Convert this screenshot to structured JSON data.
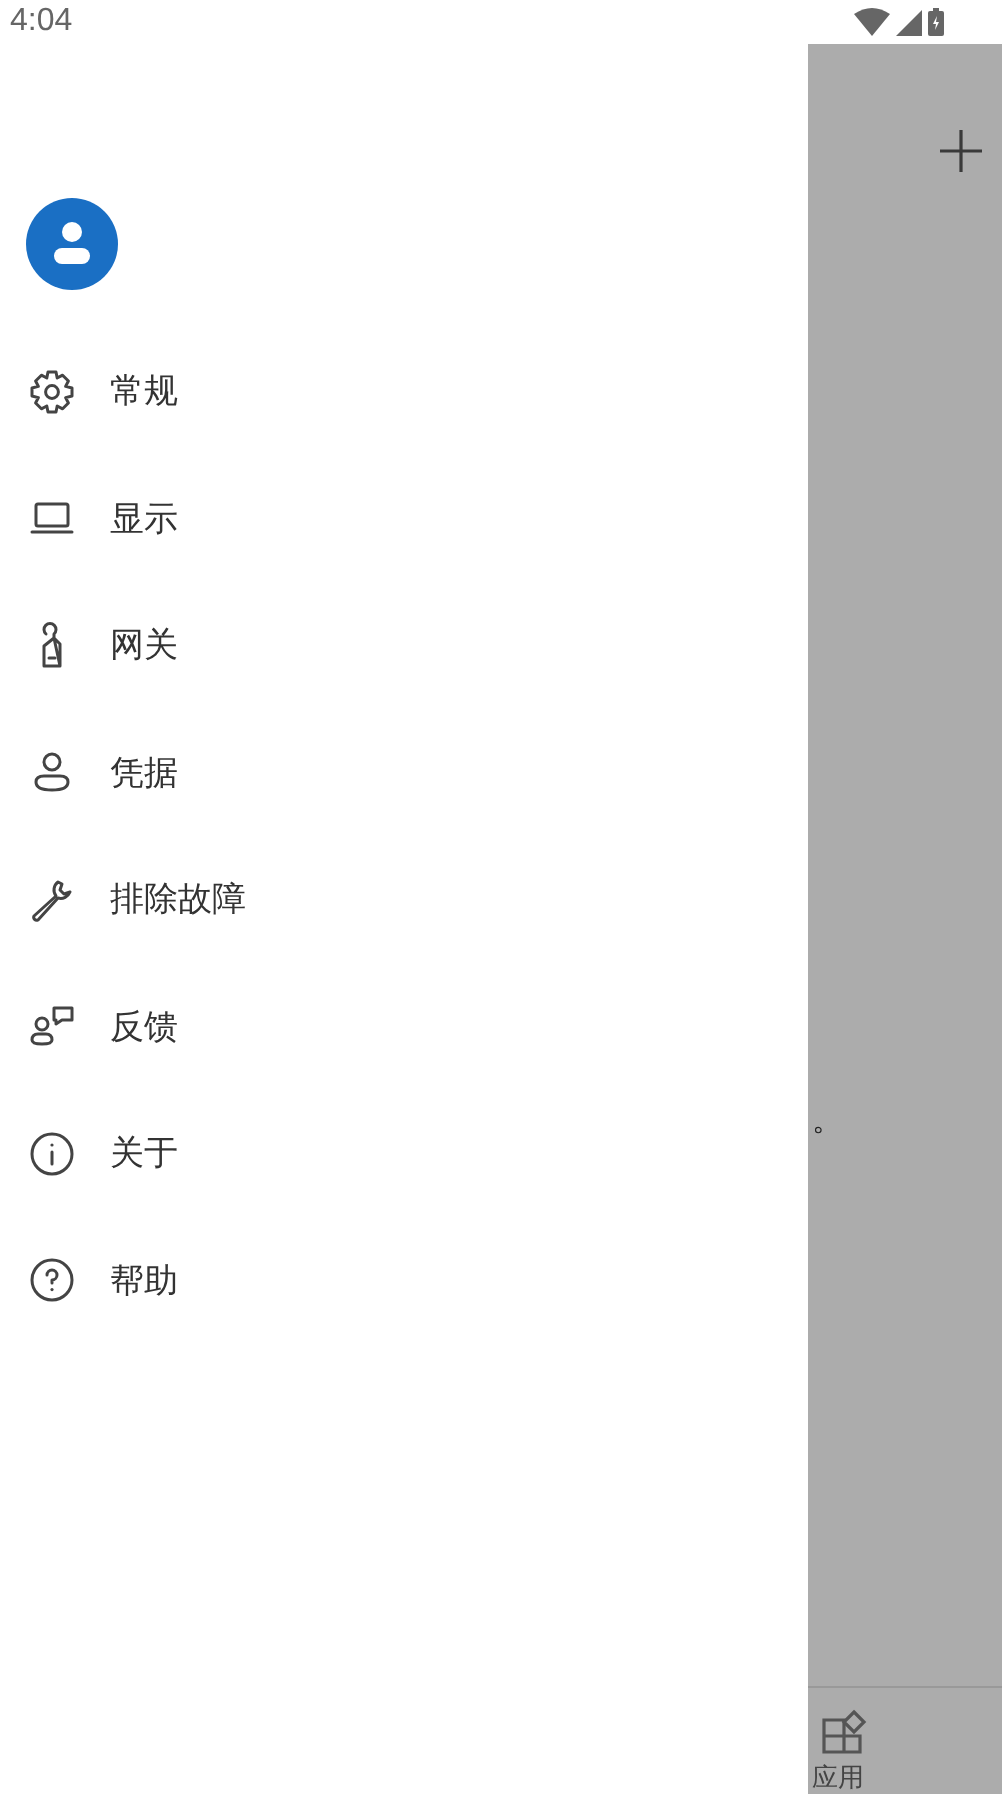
{
  "status_bar": {
    "time": "4:04"
  },
  "menu": [
    {
      "kind": "gear",
      "label": "常规"
    },
    {
      "kind": "laptop",
      "label": "显示"
    },
    {
      "kind": "tag",
      "label": "网关"
    },
    {
      "kind": "person",
      "label": "凭据"
    },
    {
      "kind": "wrench",
      "label": "排除故障"
    },
    {
      "kind": "feedback",
      "label": "反馈"
    },
    {
      "kind": "info",
      "label": "关于"
    },
    {
      "kind": "help",
      "label": "帮助"
    }
  ],
  "background": {
    "fragment": "。",
    "nav": [
      {
        "label": "应用"
      }
    ]
  }
}
